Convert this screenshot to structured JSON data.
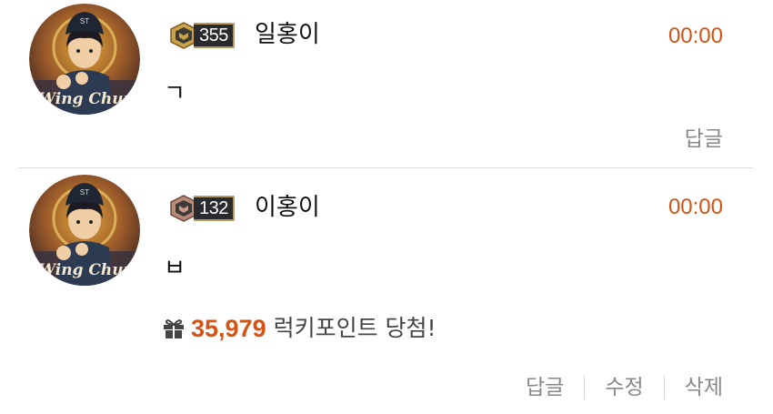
{
  "comments": [
    {
      "level": "355",
      "nickname": "일홍이",
      "time": "00:00",
      "text": "ㄱ",
      "actions": [
        "답글"
      ],
      "avatar_text": "Wing Chun",
      "avatar_cap_text": "ST"
    },
    {
      "level": "132",
      "nickname": "이홍이",
      "time": "00:00",
      "text": "ㅂ",
      "lucky_points": "35,979",
      "lucky_label": "럭키포인트 당첨!",
      "actions": [
        "답글",
        "수정",
        "삭제"
      ],
      "avatar_text": "Wing Chun",
      "avatar_cap_text": "ST"
    }
  ],
  "colors": {
    "accent": "#d45312",
    "muted": "#888888",
    "badge_bg": "#2a2b2f",
    "badge_border": "#b89b62"
  },
  "icons": {
    "badge_1": "rank-emblem-gold-icon",
    "badge_2": "rank-emblem-bronze-icon",
    "gift": "gift-icon"
  }
}
